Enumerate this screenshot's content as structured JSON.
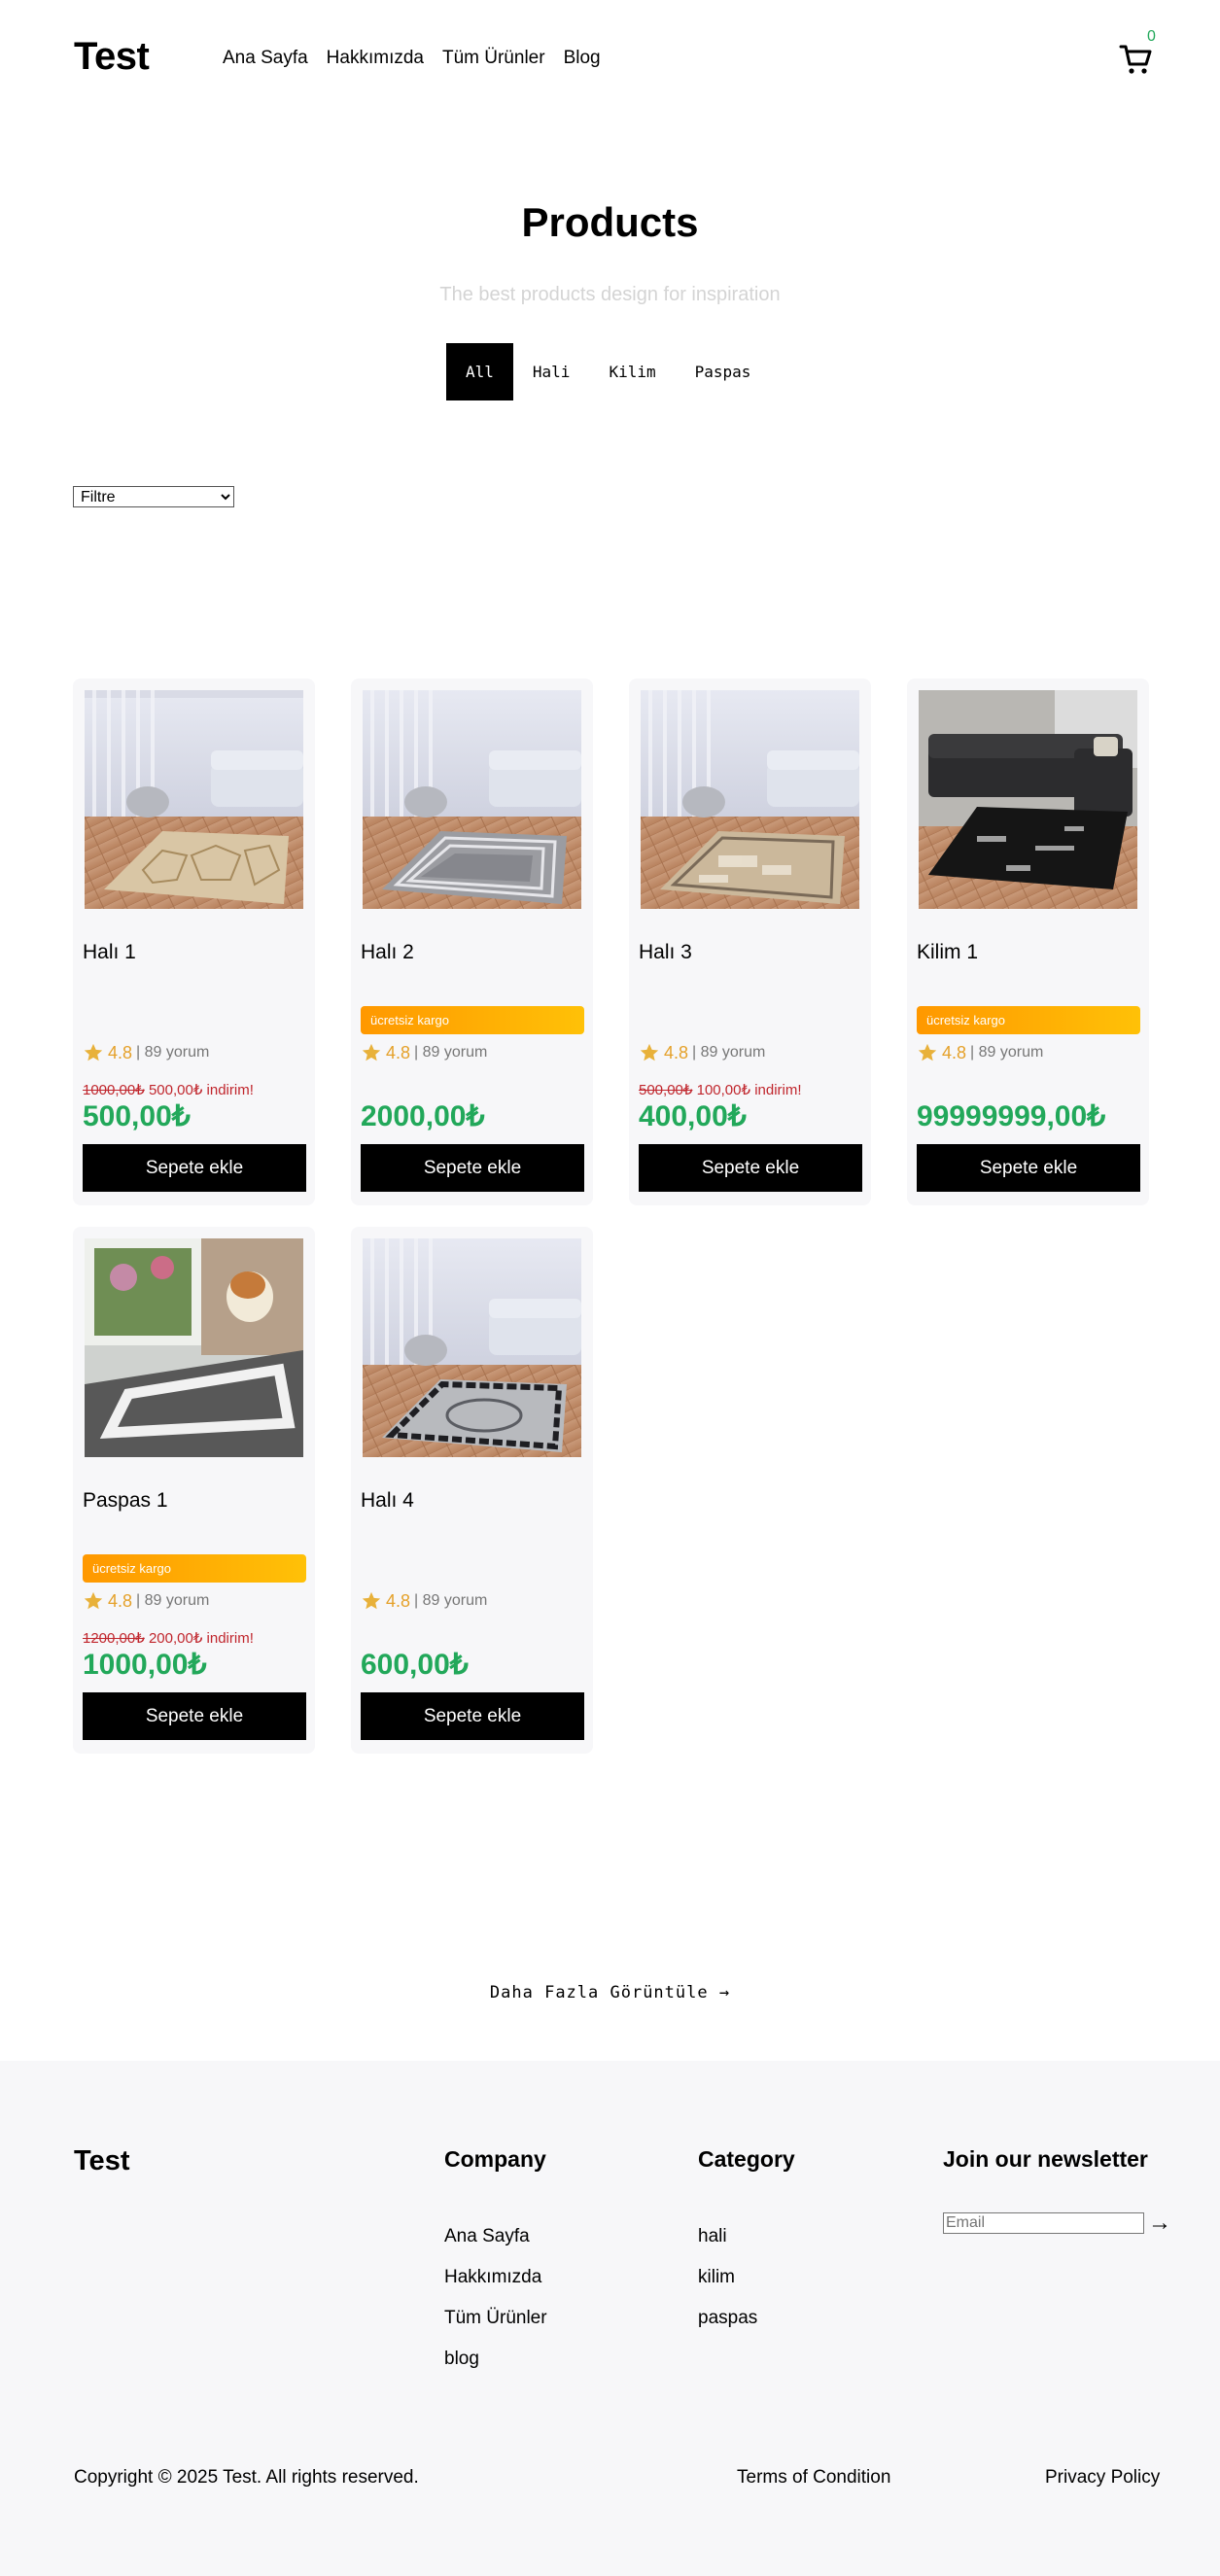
{
  "header": {
    "logo": "Test",
    "nav": [
      "Ana Sayfa",
      "Hakkımızda",
      "Tüm Ürünler",
      "Blog"
    ],
    "cart_count": "0"
  },
  "hero": {
    "title": "Products",
    "subtitle": "The best products design for inspiration",
    "tabs": [
      "All",
      "Hali",
      "Kilim",
      "Paspas"
    ],
    "active_tab": "All"
  },
  "filter": {
    "selected": "Filtre"
  },
  "products": [
    {
      "name": "Halı 1",
      "badge": "",
      "rating": "4.8",
      "reviews": "| 89 yorum",
      "old_price": "1000,00₺",
      "discount": "500,00₺ indirim!",
      "price": "500,00₺",
      "button": "Sepete ekle",
      "image": "rug-beige-geometric"
    },
    {
      "name": "Halı 2",
      "badge": "ücretsiz kargo",
      "rating": "4.8",
      "reviews": "| 89 yorum",
      "old_price": "",
      "discount": "",
      "price": "2000,00₺",
      "button": "Sepete ekle",
      "image": "rug-grey-border"
    },
    {
      "name": "Halı 3",
      "badge": "",
      "rating": "4.8",
      "reviews": "| 89 yorum",
      "old_price": "500,00₺",
      "discount": "100,00₺ indirim!",
      "price": "400,00₺",
      "button": "Sepete ekle",
      "image": "rug-beige-distressed"
    },
    {
      "name": "Kilim 1",
      "badge": "ücretsiz kargo",
      "rating": "4.8",
      "reviews": "| 89 yorum",
      "old_price": "",
      "discount": "",
      "price": "99999999,00₺",
      "button": "Sepete ekle",
      "image": "rug-black-abstract"
    },
    {
      "name": "Paspas 1",
      "badge": "ücretsiz kargo",
      "rating": "4.8",
      "reviews": "| 89 yorum",
      "old_price": "1200,00₺",
      "discount": "200,00₺ indirim!",
      "price": "1000,00₺",
      "button": "Sepete ekle",
      "image": "doormat-grey"
    },
    {
      "name": "Halı 4",
      "badge": "",
      "rating": "4.8",
      "reviews": "| 89 yorum",
      "old_price": "",
      "discount": "",
      "price": "600,00₺",
      "button": "Sepete ekle",
      "image": "rug-grey-ornate"
    }
  ],
  "more_label": "Daha Fazla Görüntüle →",
  "footer": {
    "logo": "Test",
    "company_heading": "Company",
    "company_links": [
      "Ana Sayfa",
      "Hakkımızda",
      "Tüm Ürünler",
      "blog"
    ],
    "category_heading": "Category",
    "category_links": [
      "hali",
      "kilim",
      "paspas"
    ],
    "newsletter_heading": "Join our newsletter",
    "newsletter_placeholder": "Email",
    "newsletter_arrow": "→",
    "copyright": "Copyright © 2025 Test. All rights reserved.",
    "terms": "Terms of Condition",
    "privacy": "Privacy Policy"
  },
  "colors": {
    "price": "#22a85a",
    "discount": "#c0262d",
    "rating": "#e5a12a",
    "badge_from": "#ff9800",
    "badge_to": "#ffc107"
  }
}
